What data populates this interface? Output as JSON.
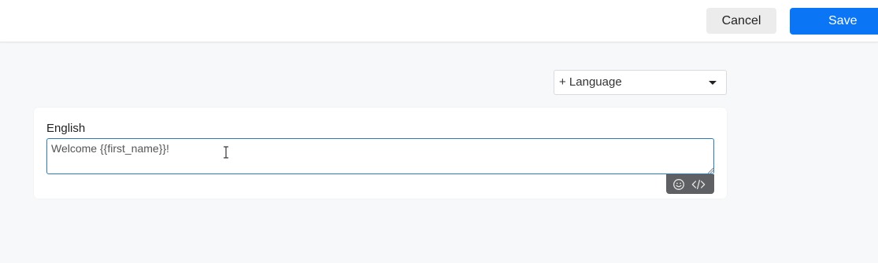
{
  "header": {
    "cancel_label": "Cancel",
    "save_label": "Save",
    "save_color": "#0b76f5"
  },
  "language_select": {
    "selected": "+ Language"
  },
  "editor": {
    "language_label": "English",
    "message_value": "Welcome {{first_name}}!",
    "focus_color": "#2b7bb9",
    "toolbar": {
      "emoji_icon": "smiley-icon",
      "code_icon": "code-brackets-icon"
    }
  }
}
